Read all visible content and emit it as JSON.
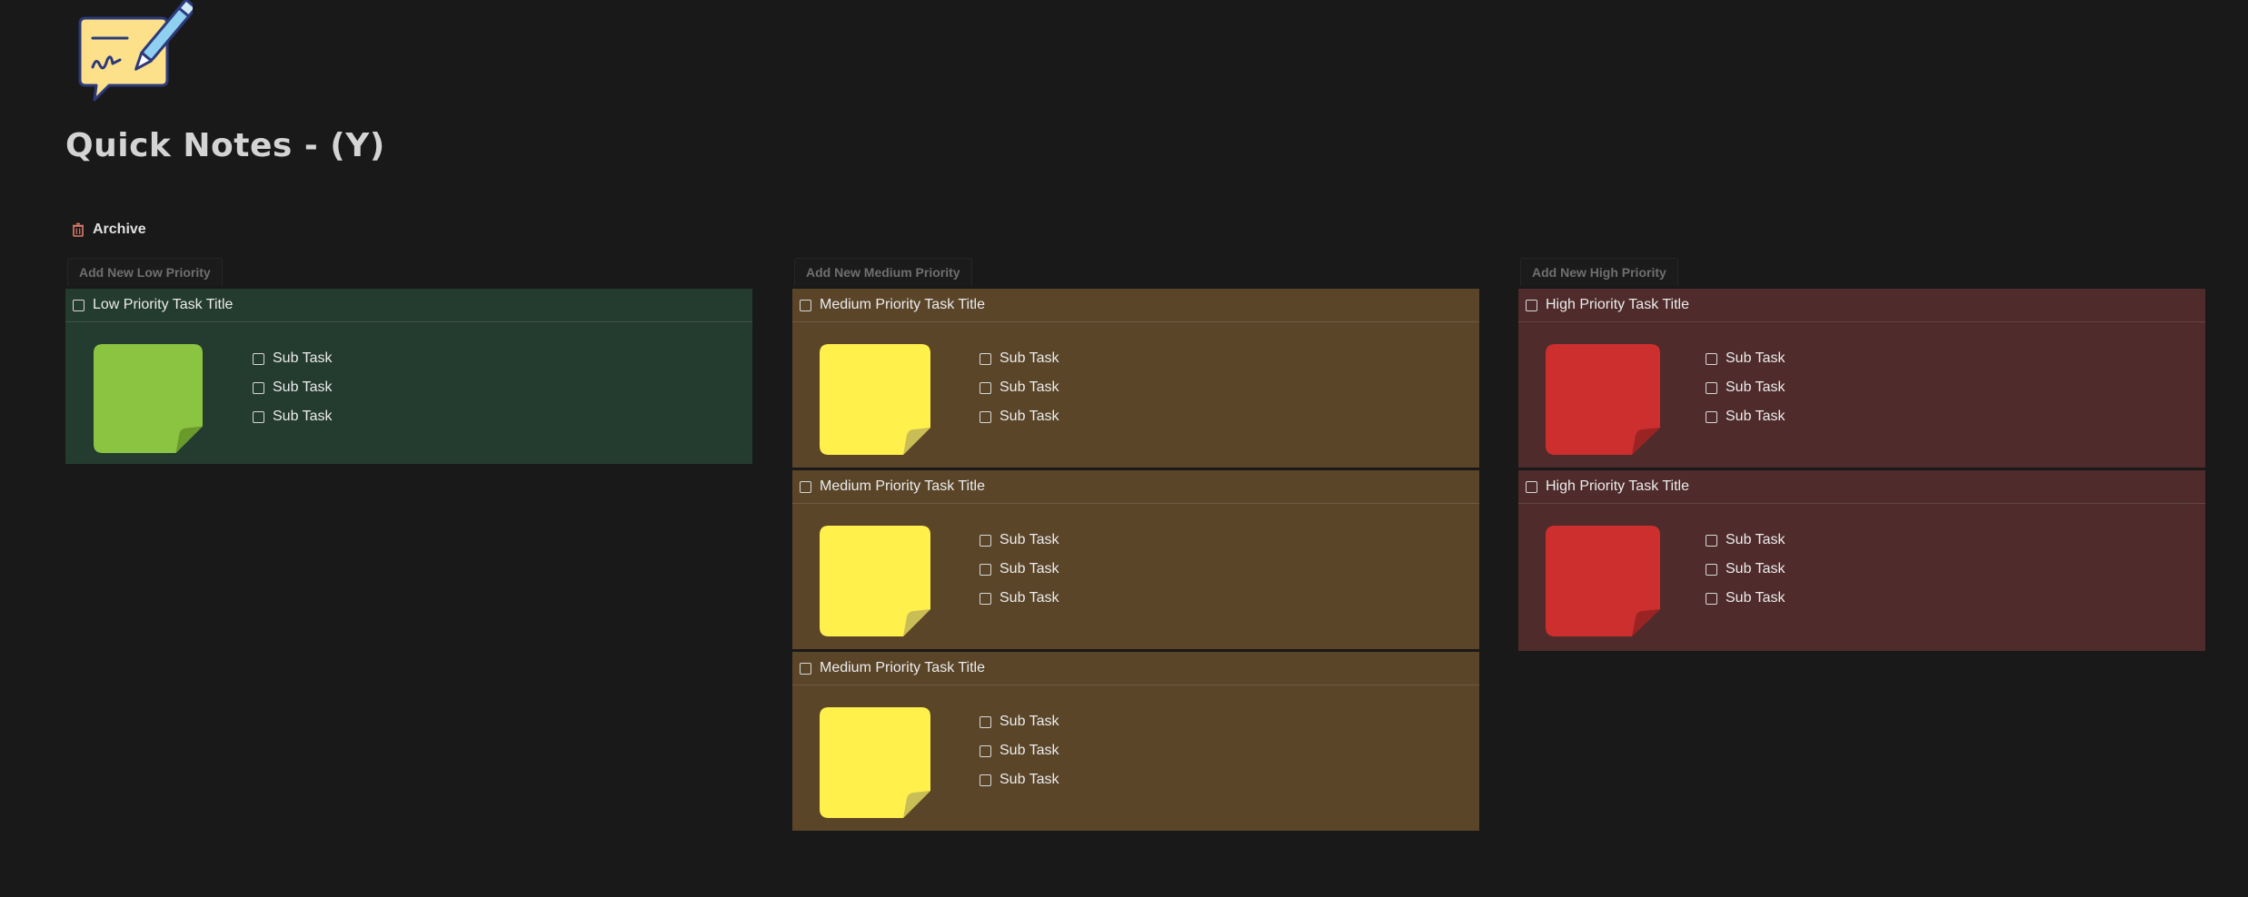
{
  "page": {
    "title": "Quick Notes - (Y)",
    "archive_label": "Archive"
  },
  "colors": {
    "background": "#191919",
    "low_card": "#243b30",
    "medium_card": "#5a4529",
    "high_card": "#4f2b2b",
    "low_note": "#8bc440",
    "medium_note": "#fff04c",
    "high_note": "#cd2f2f"
  },
  "columns": {
    "low": {
      "add_label": "Add New Low Priority",
      "cards": [
        {
          "title": "Low Priority Task Title",
          "subtasks": [
            "Sub Task",
            "Sub Task",
            "Sub Task"
          ]
        }
      ]
    },
    "medium": {
      "add_label": "Add New Medium Priority",
      "cards": [
        {
          "title": "Medium Priority Task Title",
          "subtasks": [
            "Sub Task",
            "Sub Task",
            "Sub Task"
          ]
        },
        {
          "title": "Medium Priority Task Title",
          "subtasks": [
            "Sub Task",
            "Sub Task",
            "Sub Task"
          ]
        },
        {
          "title": "Medium Priority Task Title",
          "subtasks": [
            "Sub Task",
            "Sub Task",
            "Sub Task"
          ]
        }
      ]
    },
    "high": {
      "add_label": "Add New High Priority",
      "cards": [
        {
          "title": "High Priority Task Title",
          "subtasks": [
            "Sub Task",
            "Sub Task",
            "Sub Task"
          ]
        },
        {
          "title": "High Priority Task Title",
          "subtasks": [
            "Sub Task",
            "Sub Task",
            "Sub Task"
          ]
        }
      ]
    }
  },
  "icons": {
    "page_icon": "notepad-pencil-icon",
    "archive_icon": "trash-icon",
    "note_image": "sticky-note-icon"
  }
}
